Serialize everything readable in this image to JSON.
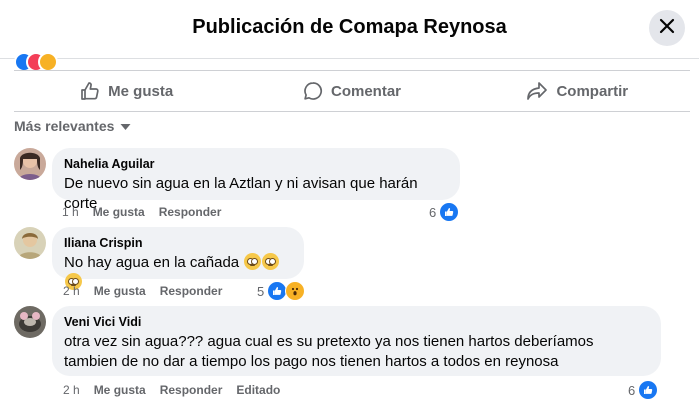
{
  "dialog": {
    "title": "Publicación de Comapa Reynosa"
  },
  "actions": {
    "like": "Me gusta",
    "comment": "Comentar",
    "share": "Compartir"
  },
  "sort": {
    "label": "Más relevantes"
  },
  "comments": [
    {
      "author": "Nahelia Aguilar",
      "text": "De nuevo sin agua en la Aztlan y ni avisan que harán corte",
      "time": "1 h",
      "like": "Me gusta",
      "reply": "Responder",
      "reactions": "6"
    },
    {
      "author": "Iliana Crispin",
      "text": "No hay agua en la cañada",
      "time": "2 h",
      "like": "Me gusta",
      "reply": "Responder",
      "reactions": "5"
    },
    {
      "author": "Veni Vici Vidi",
      "text": "otra vez sin agua??? agua cual es su pretexto ya nos tienen hartos deberíamos tambien de no dar a tiempo los pago nos tienen hartos a todos en reynosa",
      "time": "2 h",
      "like": "Me gusta",
      "reply": "Responder",
      "edited": "Editado",
      "reactions": "6"
    }
  ],
  "icons": {
    "close": "close-icon",
    "like": "thumbs-up-icon",
    "comment": "comment-bubble-icon",
    "share": "share-arrow-icon",
    "sort": "caret-down-icon"
  },
  "colors": {
    "accent": "#1877f2",
    "secondary_text": "#65676b",
    "bubble": "#f0f2f5"
  }
}
